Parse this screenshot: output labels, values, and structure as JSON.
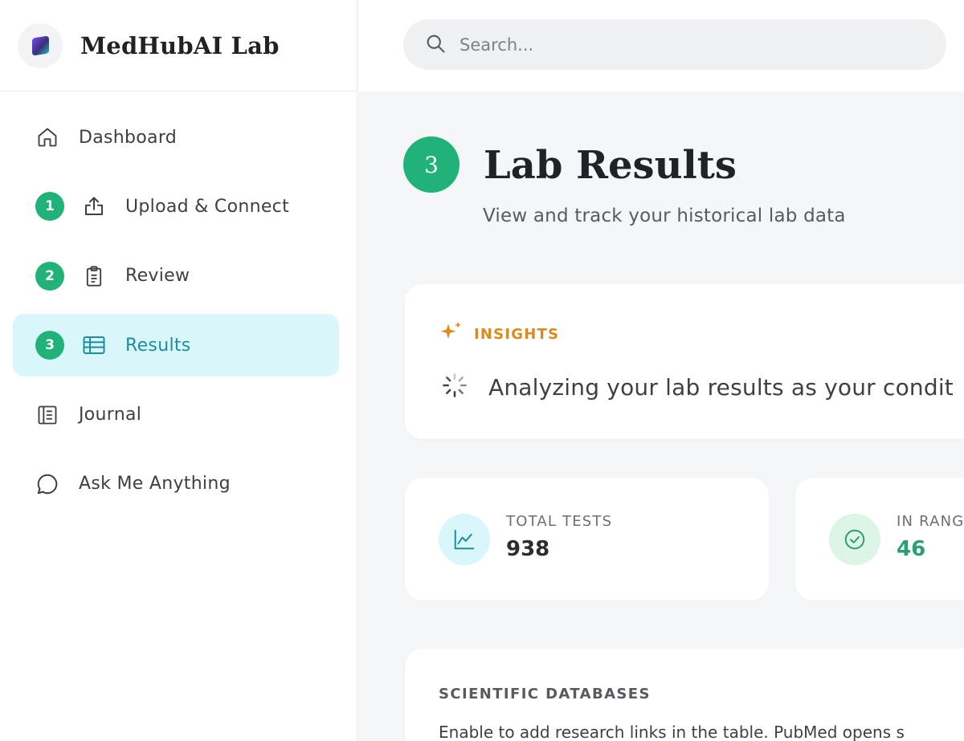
{
  "brand": {
    "name": "MedHubAI Lab",
    "logo_icon": "gradient-cube-logo"
  },
  "search": {
    "placeholder": "Search...",
    "icon": "search-icon"
  },
  "sidebar": {
    "items": [
      {
        "label": "Dashboard",
        "icon": "home-icon",
        "step": "",
        "active": false
      },
      {
        "label": "Upload & Connect",
        "icon": "upload-icon",
        "step": "1",
        "active": false
      },
      {
        "label": "Review",
        "icon": "clipboard-icon",
        "step": "2",
        "active": false
      },
      {
        "label": "Results",
        "icon": "table-icon",
        "step": "3",
        "active": true
      },
      {
        "label": "Journal",
        "icon": "journal-icon",
        "step": "",
        "active": false
      },
      {
        "label": "Ask Me Anything",
        "icon": "chat-bubble-icon",
        "step": "",
        "active": false
      }
    ]
  },
  "page": {
    "step": "3",
    "title": "Lab Results",
    "subtitle": "View and track your historical lab data"
  },
  "insights": {
    "label": "INSIGHTS",
    "message": "Analyzing your lab results as your condit"
  },
  "stats": [
    {
      "label": "TOTAL TESTS",
      "value": "938",
      "icon": "trend-chart-icon"
    },
    {
      "label": "IN RANG",
      "value": "46",
      "icon": "check-circle-icon"
    }
  ],
  "databases": {
    "title": "SCIENTIFIC DATABASES",
    "description": "Enable to add research links in the table. PubMed opens s"
  },
  "colors": {
    "accent_green": "#21b27a",
    "active_bg": "#d9f7fb",
    "active_text": "#1b8fa0",
    "insight_orange": "#d98a22"
  }
}
